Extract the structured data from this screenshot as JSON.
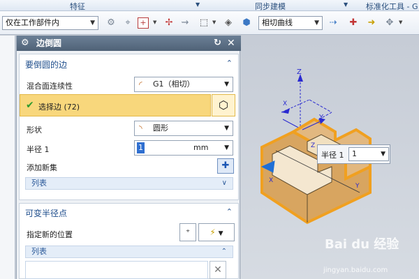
{
  "ribbon": {
    "group_feature": "特征",
    "group_sync": "同步建模",
    "group_standard": "标准化工具 - G"
  },
  "toolbar": {
    "filter_combo": "仅在工作部件内",
    "curve_combo": "相切曲线"
  },
  "dialog": {
    "title": "边倒圆",
    "section_edges": "要倒圆的边",
    "blend_continuity_label": "混合面连续性",
    "blend_continuity_value": "G1（相切）",
    "select_edge": "选择边 (72)",
    "shape_label": "形状",
    "shape_value": "圆形",
    "radius_label": "半径 1",
    "radius_value": "1",
    "radius_unit": "mm",
    "add_set_label": "添加新集",
    "list_label": "列表",
    "section_variable": "可变半径点",
    "new_position_label": "指定新的位置",
    "list_label_2": "列表"
  },
  "viewport": {
    "popup_label": "半径 1",
    "popup_value": "1",
    "axis_x": "X",
    "axis_y": "Y",
    "axis_z": "Z",
    "axis_xc": "X",
    "axis_yc": "Y",
    "axis_zc": "Z",
    "watermark_brand": "Bai du 经验",
    "watermark_url": "jingyan.baidu.com"
  },
  "colors": {
    "accent_blue": "#1f4e8c",
    "selection_yellow": "#f8d77c",
    "model_orange": "#f0a020",
    "title_bar": "#5a6e83"
  }
}
